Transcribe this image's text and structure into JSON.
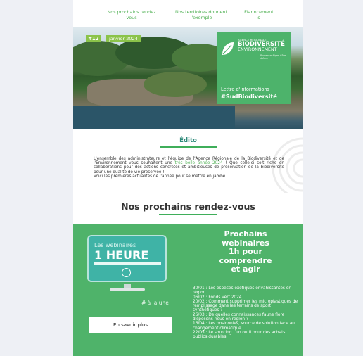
{
  "nav": {
    "links": [
      {
        "line1": "Nos prochains rendez",
        "line2": "vous"
      },
      {
        "line1": "Nos territoires donnent",
        "line2": "l'exemple"
      },
      {
        "line1": "Flanncement",
        "line2": "s"
      }
    ]
  },
  "header": {
    "issue": "#12",
    "date": "janvier 2024",
    "brand_line1": "AGENCE RÉGIONALE",
    "brand_line2": "BIODIVERSITÉ",
    "brand_line3": "ENVIRONNEMENT",
    "brand_line4": "Provence-Alpes-Côte d'Azur",
    "newsletter_line1": "Lettre d'informations",
    "newsletter_line2": "#SudBiodiversité"
  },
  "edito": {
    "title": "Édito",
    "text_before": "L'ensemble des administrateurs et l'équipe de l'Agence Régionale de la Biodiversité et de l'Environnement vous souhaitent une ",
    "highlight": "très belle année 2024",
    "text_after": " ! Que celle-ci soit riche en collaborations pour des actions concrètes et ambitieuses de préservation de la biodiversité pour une qualité de vie préservée !",
    "line2": "Voici les premières actualités de l'année pour se mettre en jambe..."
  },
  "rdv": {
    "title": "Nos prochains rendez-vous"
  },
  "webinar": {
    "screen_line1": "Les webinaires",
    "screen_line2": "1 HEURE",
    "tag": "# à la une",
    "button": "En savoir plus",
    "title_lines": [
      "Prochains",
      "webinaires",
      "1h pour",
      "comprendre",
      "et agir"
    ],
    "items": [
      "30/01 : Les espèces exotiques envahissantes en région",
      "06/02 : Fonds vert 2024",
      "20/02 : Comment supprimer les microplastiques de remplissage dans les terrains de sport synthétiques ?",
      "26/03 : De quelles connaissances faune flore disposons-nous en région ?",
      "16/04 : Les posidonies, source de solution face au changement climatique",
      "22/05 : Le sourcing : un outil pour des achats publics durables."
    ]
  },
  "colors": {
    "accent_green": "#4fb36a",
    "title_teal": "#2e8a7a",
    "page_bg": "#eef0f5"
  }
}
